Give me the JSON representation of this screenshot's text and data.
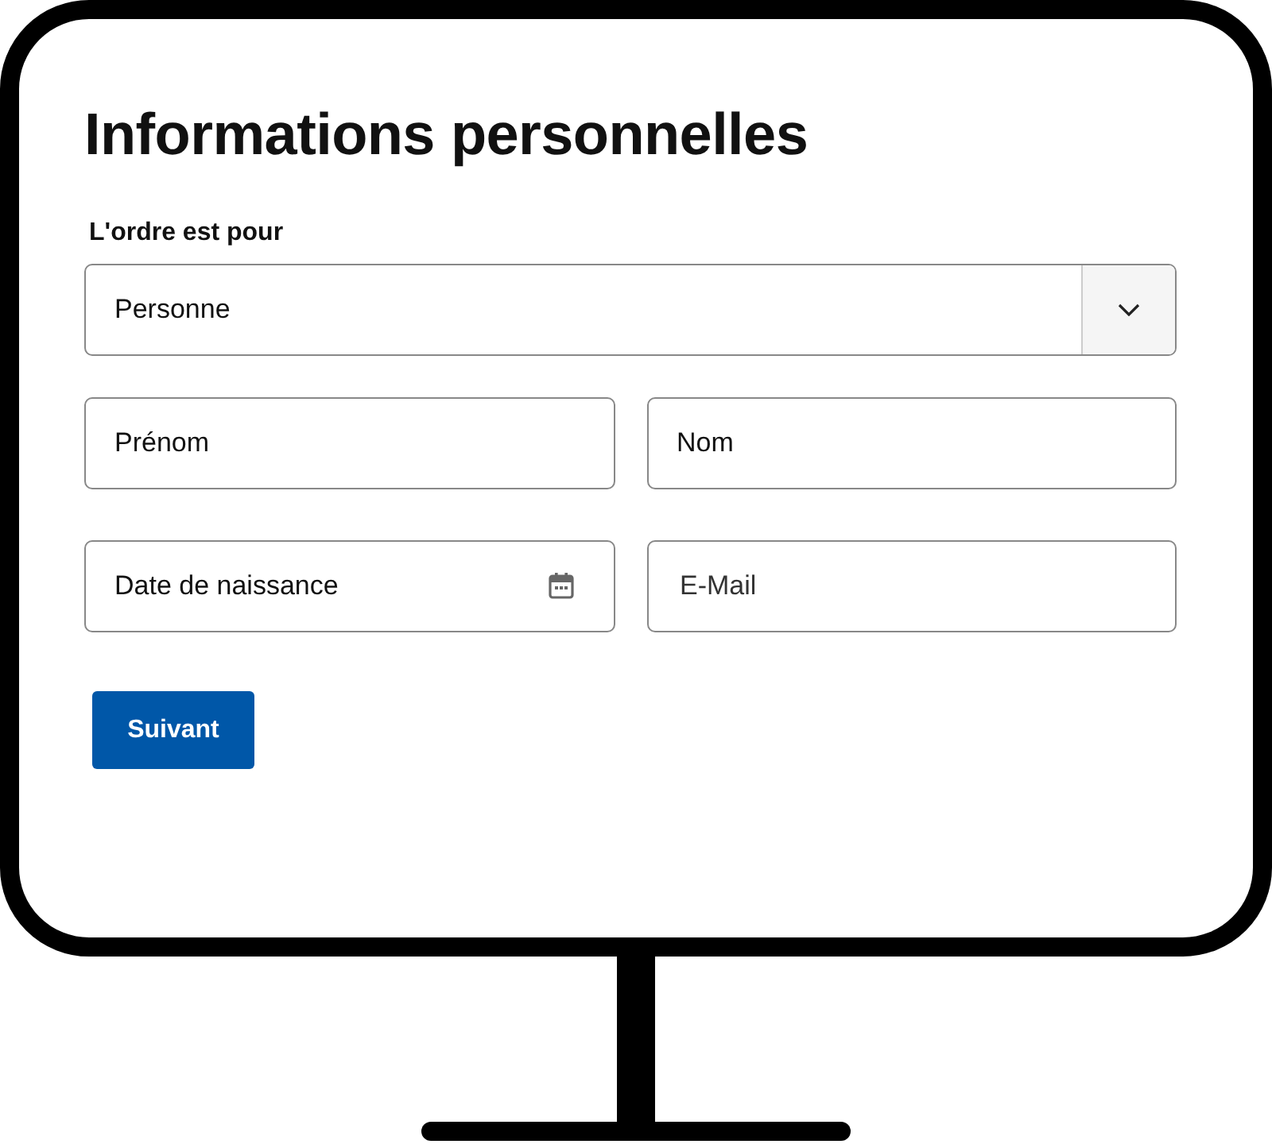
{
  "title": "Informations personnelles",
  "order_for": {
    "label": "L'ordre est pour",
    "value": "Personne"
  },
  "fields": [
    {
      "placeholder": "Prénom",
      "kind": "label"
    },
    {
      "placeholder": "Nom",
      "kind": "label"
    },
    {
      "placeholder": "Date de naissance",
      "kind": "date"
    },
    {
      "placeholder": "E-Mail",
      "kind": "placeholder"
    }
  ],
  "button": "Suivant"
}
